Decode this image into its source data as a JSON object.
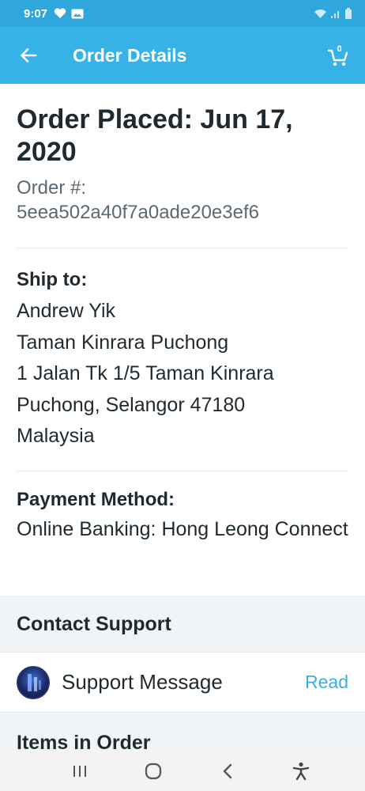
{
  "status_bar": {
    "time": "9:07",
    "icons": [
      "heart-icon",
      "gallery-icon",
      "wifi-icon",
      "signal-icon",
      "battery-icon"
    ]
  },
  "app_bar": {
    "title": "Order Details",
    "back_icon": "arrow-left-icon",
    "cart_icon": "cart-icon",
    "cart_count": "0",
    "background": "#36b2e6"
  },
  "order": {
    "placed_label": "Order Placed: Jun 17, 2020",
    "number_label": "Order #:",
    "number_value": "5eea502a40f7a0ade20e3ef6"
  },
  "shipping": {
    "label": "Ship to:",
    "lines": [
      "Andrew Yik",
      "Taman Kinrara Puchong",
      "1 Jalan Tk 1/5 Taman Kinrara",
      "Puchong, Selangor 47180",
      "Malaysia"
    ]
  },
  "payment": {
    "label": "Payment Method:",
    "value": "Online Banking: Hong Leong Connect"
  },
  "support": {
    "header": "Contact Support",
    "message_label": "Support Message",
    "action": "Read",
    "accent": "#3aaee2"
  },
  "items": {
    "header": "Items in Order"
  },
  "nav_bar": {
    "icons": [
      "recent-apps-icon",
      "home-icon",
      "back-icon",
      "accessibility-icon"
    ]
  }
}
